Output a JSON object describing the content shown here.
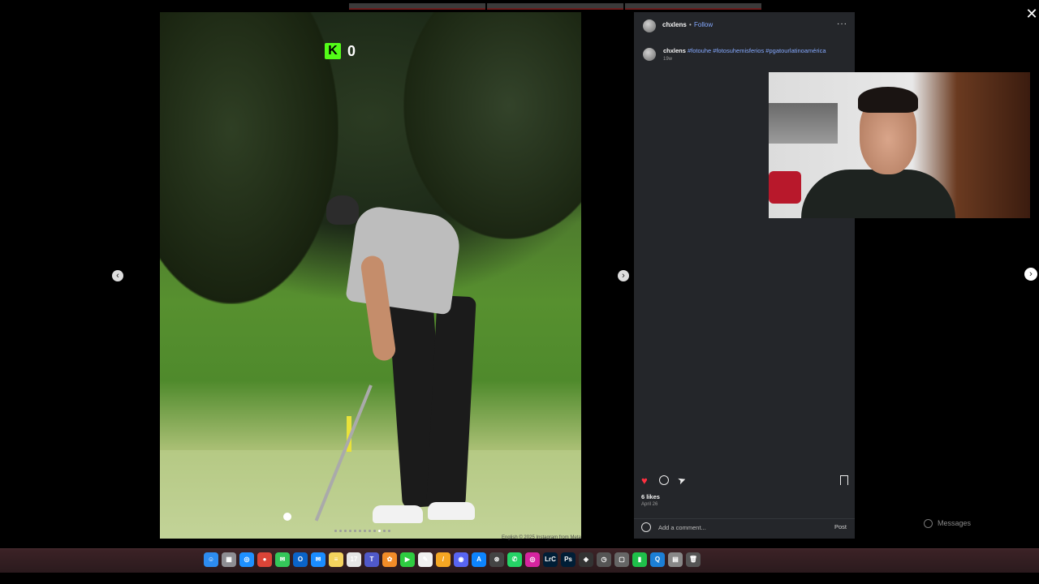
{
  "header": {
    "username": "chxlens",
    "separator": "•",
    "follow_label": "Follow",
    "more_label": "···"
  },
  "caption": {
    "username": "chxlens",
    "hashtags": "#fotouhe #fotosuhemisferios #pgatourlatinoamérica",
    "time": "19w"
  },
  "overlay": {
    "kick_logo": "K",
    "viewer_count": "0"
  },
  "post": {
    "likes": "6 likes",
    "date": "April 26",
    "comment_placeholder": "Add a comment...",
    "post_label": "Post",
    "like_color": "#ff3040"
  },
  "navigation": {
    "prev": "‹",
    "next": "›",
    "close": "✕"
  },
  "messages": {
    "label": "Messages"
  },
  "footer": {
    "note": "English     © 2025 Instagram from Meta"
  },
  "carousel": {
    "total": 12,
    "active": 9
  },
  "dock": {
    "apps": [
      {
        "name": "Finder",
        "glyph": "☺",
        "color": "#2d8cf0"
      },
      {
        "name": "Launchpad",
        "glyph": "▦",
        "color": "#8e8e93"
      },
      {
        "name": "Safari",
        "glyph": "◎",
        "color": "#1e90ff"
      },
      {
        "name": "Chrome",
        "glyph": "●",
        "color": "#db4437"
      },
      {
        "name": "Messages",
        "glyph": "✉",
        "color": "#34c759"
      },
      {
        "name": "Outlook",
        "glyph": "O",
        "color": "#0a64c8"
      },
      {
        "name": "Mail",
        "glyph": "✉",
        "color": "#1a8cff"
      },
      {
        "name": "Notes",
        "glyph": "≡",
        "color": "#f4d35e"
      },
      {
        "name": "Calendar",
        "glyph": "17",
        "color": "#e6e6e6"
      },
      {
        "name": "Teams",
        "glyph": "T",
        "color": "#5059c9"
      },
      {
        "name": "Photos",
        "glyph": "✿",
        "color": "#f28c28"
      },
      {
        "name": "FaceTime",
        "glyph": "▶",
        "color": "#2ecc40"
      },
      {
        "name": "TextEdit",
        "glyph": "✎",
        "color": "#f0f0f0"
      },
      {
        "name": "Pages",
        "glyph": "/",
        "color": "#f5a623"
      },
      {
        "name": "Discord",
        "glyph": "◉",
        "color": "#5865f2"
      },
      {
        "name": "App Store",
        "glyph": "A",
        "color": "#0d84ff"
      },
      {
        "name": "ChatGPT",
        "glyph": "⊛",
        "color": "#444"
      },
      {
        "name": "WhatsApp",
        "glyph": "✆",
        "color": "#25d366"
      },
      {
        "name": "Instagram",
        "glyph": "◎",
        "color": "#d6249f"
      },
      {
        "name": "Lightroom",
        "glyph": "LrC",
        "color": "#001e36"
      },
      {
        "name": "Photoshop",
        "glyph": "Ps",
        "color": "#001e36"
      },
      {
        "name": "DaVinci",
        "glyph": "◈",
        "color": "#333"
      },
      {
        "name": "Activity",
        "glyph": "◷",
        "color": "#555"
      },
      {
        "name": "Finder2",
        "glyph": "▢",
        "color": "#666"
      },
      {
        "name": "Numbers",
        "glyph": "▮",
        "color": "#1fbf4a"
      },
      {
        "name": "QuickTime",
        "glyph": "Q",
        "color": "#1c7fd6"
      },
      {
        "name": "Preview",
        "glyph": "▤",
        "color": "#888"
      },
      {
        "name": "Trash",
        "glyph": "🗑",
        "color": "#555"
      }
    ]
  }
}
